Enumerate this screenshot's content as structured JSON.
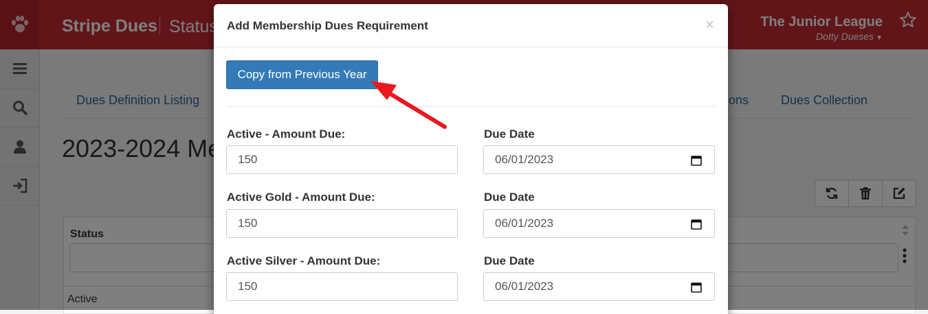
{
  "app": {
    "title": "Stripe Dues",
    "page_name": "Status",
    "org_name": "The Junior League",
    "user_name": "Dotty Dueses",
    "brand_color": "#c22a33"
  },
  "sidebar": {
    "items": [
      {
        "icon": "menu-icon"
      },
      {
        "icon": "search-icon"
      },
      {
        "icon": "user-icon"
      },
      {
        "icon": "sign-in-icon"
      }
    ]
  },
  "tabs": [
    "Dues Definition Listing",
    "tions",
    "Dues Collection"
  ],
  "main": {
    "heading": "2023-2024 Me"
  },
  "grid": {
    "column_title": "Status",
    "first_row_value": "Active"
  },
  "modal": {
    "title": "Add Membership Dues Requirement",
    "close_label": "×",
    "copy_button_label": "Copy from Previous Year",
    "rows": [
      {
        "amount_label": "Active - Amount Due:",
        "amount_value": "150",
        "date_label": "Due Date",
        "date_value": "06/01/2023"
      },
      {
        "amount_label": "Active Gold - Amount Due:",
        "amount_value": "150",
        "date_label": "Due Date",
        "date_value": "06/01/2023"
      },
      {
        "amount_label": "Active Silver - Amount Due:",
        "amount_value": "150",
        "date_label": "Due Date",
        "date_value": "06/01/2023"
      }
    ],
    "annotation_color": "#e8191f"
  }
}
